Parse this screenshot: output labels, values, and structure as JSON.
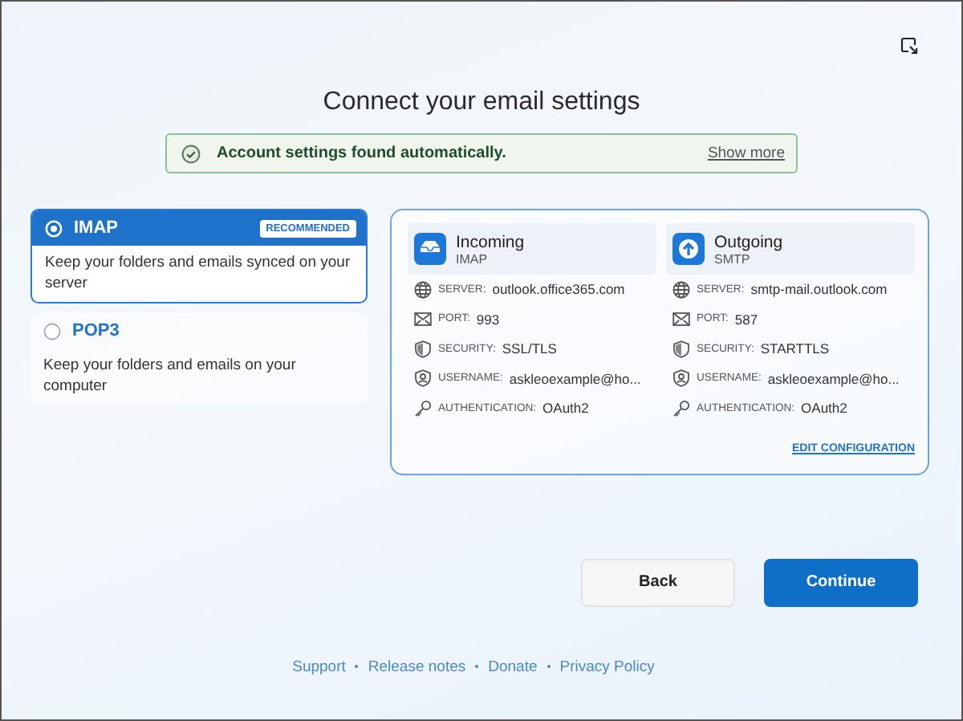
{
  "title": "Connect your email settings",
  "banner": {
    "message": "Account settings found automatically.",
    "link": "Show more"
  },
  "protocols": [
    {
      "name": "IMAP",
      "badge": "RECOMMENDED",
      "description": "Keep your folders and emails synced on your server",
      "selected": true
    },
    {
      "name": "POP3",
      "description": "Keep your folders and emails on your computer",
      "selected": false
    }
  ],
  "servers": [
    {
      "kind": "incoming",
      "title": "Incoming",
      "protocol": "IMAP",
      "fields": [
        {
          "kind": "server",
          "label": "SERVER:",
          "value": "outlook.office365.com"
        },
        {
          "kind": "port",
          "label": "PORT:",
          "value": "993"
        },
        {
          "kind": "security",
          "label": "SECURITY:",
          "value": "SSL/TLS"
        },
        {
          "kind": "username",
          "label": "USERNAME:",
          "value": "askleoexample@ho..."
        },
        {
          "kind": "authentication",
          "label": "AUTHENTICATION:",
          "value": "OAuth2"
        }
      ]
    },
    {
      "kind": "outgoing",
      "title": "Outgoing",
      "protocol": "SMTP",
      "fields": [
        {
          "kind": "server",
          "label": "SERVER:",
          "value": "smtp-mail.outlook.com"
        },
        {
          "kind": "port",
          "label": "PORT:",
          "value": "587"
        },
        {
          "kind": "security",
          "label": "SECURITY:",
          "value": "STARTTLS"
        },
        {
          "kind": "username",
          "label": "USERNAME:",
          "value": "askleoexample@ho..."
        },
        {
          "kind": "authentication",
          "label": "AUTHENTICATION:",
          "value": "OAuth2"
        }
      ]
    }
  ],
  "edit_link": "EDIT CONFIGURATION",
  "buttons": {
    "back": "Back",
    "continue": "Continue"
  },
  "footer_links": [
    "Support",
    "Release notes",
    "Donate",
    "Privacy Policy"
  ]
}
